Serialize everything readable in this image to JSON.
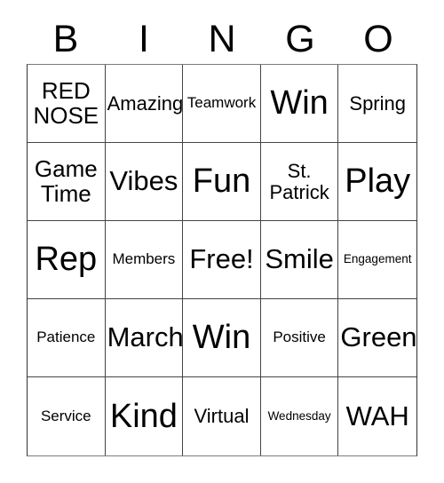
{
  "card": {
    "title": "BINGO",
    "header_letters": [
      "B",
      "I",
      "N",
      "G",
      "O"
    ],
    "grid_size": "5x5",
    "free_space": "Free!",
    "colors": {
      "background": "#ffffff",
      "text": "#000000",
      "grid_line": "#444444",
      "outer_border": "#333333"
    },
    "cells": [
      {
        "text": "RED\nNOSE",
        "size": "md",
        "column": "B",
        "row": 1
      },
      {
        "text": "Amazing",
        "size": "sm",
        "column": "I",
        "row": 1
      },
      {
        "text": "Teamwork",
        "size": "xs",
        "column": "N",
        "row": 1
      },
      {
        "text": "Win",
        "size": "xl",
        "column": "G",
        "row": 1
      },
      {
        "text": "Spring",
        "size": "sm",
        "column": "O",
        "row": 1
      },
      {
        "text": "Game\nTime",
        "size": "md",
        "column": "B",
        "row": 2
      },
      {
        "text": "Vibes",
        "size": "lg",
        "column": "I",
        "row": 2
      },
      {
        "text": "Fun",
        "size": "xl",
        "column": "N",
        "row": 2
      },
      {
        "text": "St.\nPatrick",
        "size": "sm",
        "column": "G",
        "row": 2
      },
      {
        "text": "Play",
        "size": "xl",
        "column": "O",
        "row": 2
      },
      {
        "text": "Rep",
        "size": "xl",
        "column": "B",
        "row": 3
      },
      {
        "text": "Members",
        "size": "xs",
        "column": "I",
        "row": 3
      },
      {
        "text": "Free!",
        "size": "lg",
        "column": "N",
        "row": 3
      },
      {
        "text": "Smile",
        "size": "lg",
        "column": "G",
        "row": 3
      },
      {
        "text": "Engagement",
        "size": "xxs",
        "column": "O",
        "row": 3
      },
      {
        "text": "Patience",
        "size": "xs",
        "column": "B",
        "row": 4
      },
      {
        "text": "March",
        "size": "lg",
        "column": "I",
        "row": 4
      },
      {
        "text": "Win",
        "size": "xl",
        "column": "N",
        "row": 4
      },
      {
        "text": "Positive",
        "size": "xs",
        "column": "G",
        "row": 4
      },
      {
        "text": "Green",
        "size": "lg",
        "column": "O",
        "row": 4
      },
      {
        "text": "Service",
        "size": "xs",
        "column": "B",
        "row": 5
      },
      {
        "text": "Kind",
        "size": "xl",
        "column": "I",
        "row": 5
      },
      {
        "text": "Virtual",
        "size": "sm",
        "column": "N",
        "row": 5
      },
      {
        "text": "Wednesday",
        "size": "xxs",
        "column": "G",
        "row": 5
      },
      {
        "text": "WAH",
        "size": "lg",
        "column": "O",
        "row": 5
      }
    ]
  }
}
